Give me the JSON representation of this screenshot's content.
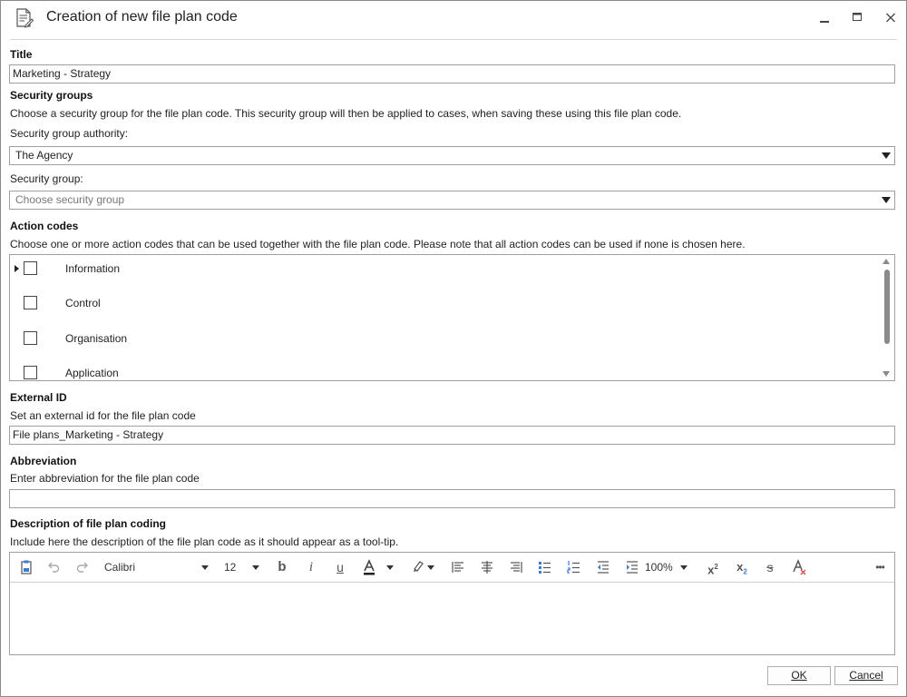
{
  "window": {
    "title": "Creation of new file plan code",
    "minimize_glyph": "‒",
    "maximize_glyph": "□",
    "close_glyph": "✕"
  },
  "title_section": {
    "label": "Title",
    "value": "Marketing - Strategy"
  },
  "security_groups": {
    "heading": "Security groups",
    "description": "Choose a security group for the file plan code. This security group will then be applied to cases, when saving these using this file plan code.",
    "authority_label": "Security group authority:",
    "authority_value": "The Agency",
    "group_label": "Security group:",
    "group_placeholder": "Choose security group"
  },
  "action_codes": {
    "heading": "Action codes",
    "description": "Choose one or more action codes that can be used together with the file plan code. Please note that all action codes can be used if none is chosen here.",
    "items": [
      {
        "label": "Information",
        "checked": false
      },
      {
        "label": "Control",
        "checked": false
      },
      {
        "label": "Organisation",
        "checked": false
      },
      {
        "label": "Application",
        "checked": false
      }
    ]
  },
  "external_id": {
    "heading": "External ID",
    "description": "Set an external id for the file plan code",
    "value": "File plans_Marketing - Strategy"
  },
  "abbreviation": {
    "heading": "Abbreviation",
    "description": "Enter abbreviation for the file plan code",
    "value": ""
  },
  "description_section": {
    "heading": "Description of file plan coding",
    "description": "Include here the description of the file plan code as it should appear as a tool-tip."
  },
  "editor_toolbar": {
    "font": "Calibri",
    "size": "12",
    "zoom": "100%",
    "more": "•••",
    "icons": [
      "paste-icon",
      "undo-icon",
      "redo-icon",
      "bold-icon",
      "italic-icon",
      "underline-icon",
      "font-color-icon",
      "highlight-icon",
      "align-left-icon",
      "align-center-icon",
      "align-right-icon",
      "bullet-list-icon",
      "numbered-list-icon",
      "decrease-indent-icon",
      "increase-indent-icon",
      "superscript-icon",
      "subscript-icon",
      "strikethrough-icon",
      "clear-format-icon"
    ]
  },
  "buttons": {
    "ok": "OK",
    "cancel": "Cancel"
  }
}
